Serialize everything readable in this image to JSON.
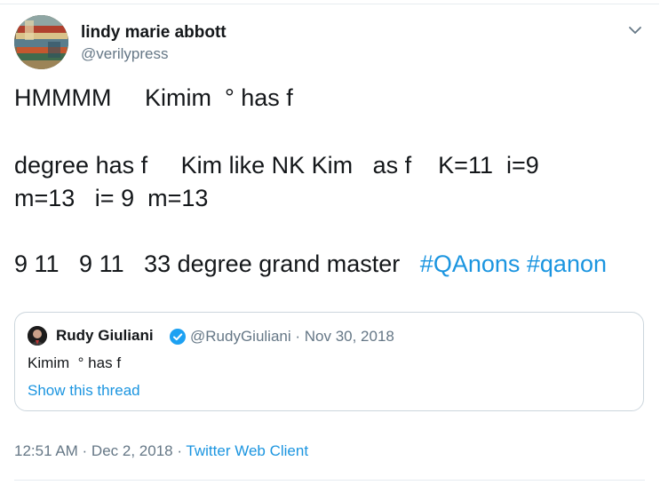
{
  "author": {
    "name": "lindy marie abbott",
    "handle": "@verilypress",
    "avatar_icon": "avatar-photo"
  },
  "menu": {
    "icon": "chevron-down-icon"
  },
  "tweet": {
    "line1": "HMMMM     Kimim  ° has f",
    "line2": "degree has f     Kim like NK Kim   as f    K=11  i=9",
    "line3": "m=13   i= 9  m=13",
    "line4_text": "9 11   9 11   33 degree grand master   ",
    "hashtags": [
      "#QAnons",
      "#qanon"
    ]
  },
  "quoted": {
    "name": "Rudy Giuliani",
    "verified_icon": "verified-badge-icon",
    "meta": "@RudyGiuliani · Nov 30, 2018",
    "text": "Kimim  ° has f",
    "thread_link": "Show this thread"
  },
  "footer": {
    "timestamp": "12:51 AM · Dec 2, 2018 · ",
    "client": "Twitter Web Client"
  },
  "colors": {
    "link": "#1b95e0",
    "secondary": "#657786",
    "text": "#14171a",
    "border": "#ccd6dd"
  }
}
